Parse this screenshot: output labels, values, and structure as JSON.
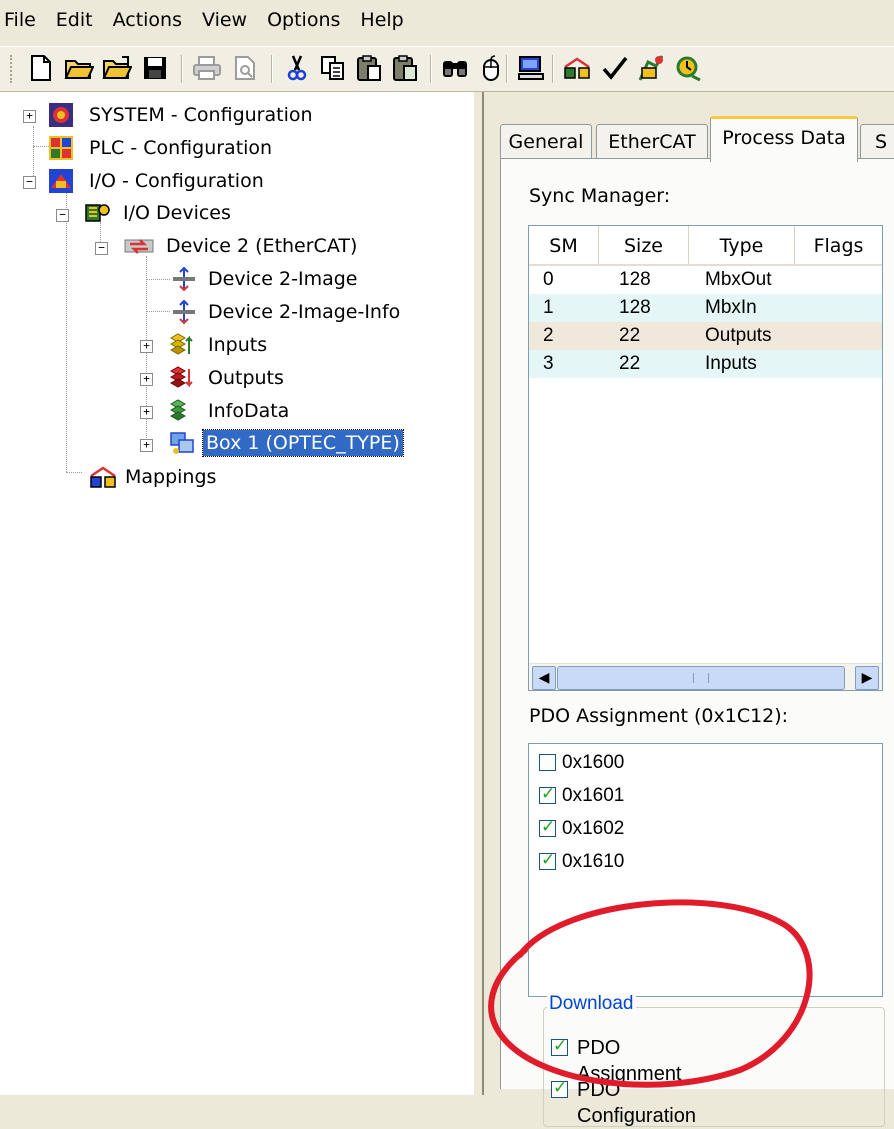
{
  "menu": [
    "File",
    "Edit",
    "Actions",
    "View",
    "Options",
    "Help"
  ],
  "toolbar": {
    "buttons": [
      {
        "name": "new-icon",
        "glyph": "🗋"
      },
      {
        "name": "open-icon",
        "glyph": "📂"
      },
      {
        "name": "open-remote-icon",
        "glyph": "📂"
      },
      {
        "name": "save-icon",
        "glyph": "💾"
      },
      {
        "name": "print-icon",
        "glyph": "🖨"
      },
      {
        "name": "print-preview-icon",
        "glyph": "🔍"
      },
      {
        "name": "cut-icon",
        "glyph": "✂"
      },
      {
        "name": "copy-icon",
        "glyph": "⎘"
      },
      {
        "name": "paste-icon",
        "glyph": "📋"
      },
      {
        "name": "paste-with-links-icon",
        "glyph": "📋"
      },
      {
        "name": "find-icon",
        "glyph": "🔭"
      },
      {
        "name": "mouse-icon",
        "glyph": "🖱"
      },
      {
        "name": "computer-icon",
        "glyph": "🖥"
      },
      {
        "name": "mappings-icon",
        "glyph": "▦"
      },
      {
        "name": "check-icon",
        "glyph": "✓"
      },
      {
        "name": "activate-config-icon",
        "glyph": "⚙"
      },
      {
        "name": "restart-icon",
        "glyph": "⟳"
      }
    ]
  },
  "tree": {
    "items": [
      {
        "label": "SYSTEM - Configuration",
        "icon": "system-icon"
      },
      {
        "label": "PLC - Configuration",
        "icon": "plc-icon"
      },
      {
        "label": "I/O - Configuration",
        "icon": "io-config-icon"
      },
      {
        "label": "I/O Devices",
        "icon": "io-devices-icon"
      },
      {
        "label": "Device 2 (EtherCAT)",
        "icon": "ethercat-device-icon"
      },
      {
        "label": "Device 2-Image",
        "icon": "image-icon"
      },
      {
        "label": "Device 2-Image-Info",
        "icon": "image-info-icon"
      },
      {
        "label": "Inputs",
        "icon": "inputs-icon"
      },
      {
        "label": "Outputs",
        "icon": "outputs-icon"
      },
      {
        "label": "InfoData",
        "icon": "infodata-icon"
      },
      {
        "label": "Box 1 (OPTEC_TYPE)",
        "icon": "box-icon",
        "selected": true
      },
      {
        "label": "Mappings",
        "icon": "mappings-tree-icon"
      }
    ]
  },
  "tabs": [
    {
      "label": "General"
    },
    {
      "label": "EtherCAT"
    },
    {
      "label": "Process Data",
      "active": true
    },
    {
      "label": "S"
    }
  ],
  "sync_manager": {
    "label": "Sync Manager:",
    "columns": [
      "SM",
      "Size",
      "Type",
      "Flags"
    ],
    "rows": [
      {
        "sm": "0",
        "size": "128",
        "type": "MbxOut",
        "flags": ""
      },
      {
        "sm": "1",
        "size": "128",
        "type": "MbxIn",
        "flags": ""
      },
      {
        "sm": "2",
        "size": "22",
        "type": "Outputs",
        "flags": ""
      },
      {
        "sm": "3",
        "size": "22",
        "type": "Inputs",
        "flags": ""
      }
    ]
  },
  "pdo_assignment": {
    "label": "PDO Assignment (0x1C12):",
    "items": [
      {
        "label": "0x1600",
        "checked": false
      },
      {
        "label": "0x1601",
        "checked": true
      },
      {
        "label": "0x1602",
        "checked": true
      },
      {
        "label": "0x1610",
        "checked": true
      }
    ]
  },
  "download": {
    "legend": "Download",
    "items": [
      {
        "label": "PDO Assignment",
        "checked": true
      },
      {
        "label": "PDO Configuration",
        "checked": true
      }
    ]
  },
  "colors": {
    "row_alt_blue": "#e4f7f6",
    "row_alt_tan": "#efe9dc",
    "selection": "#316ac5",
    "annotation_circle": "#e01b2a"
  }
}
